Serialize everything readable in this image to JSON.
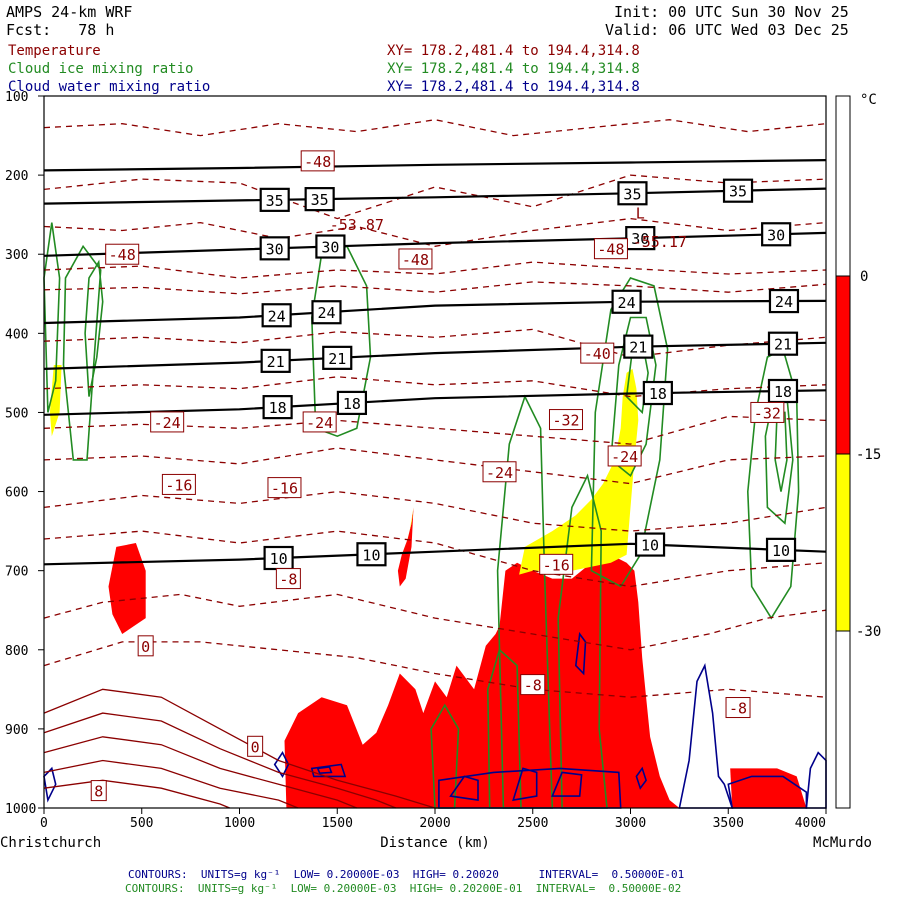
{
  "header": {
    "model": "AMPS 24-km WRF",
    "forecast": "Fcst:   78 h",
    "init": "Init: 00 UTC Sun 30 Nov 25",
    "valid": "Valid: 06 UTC Wed 03 Dec 25",
    "fields": [
      {
        "name": "Temperature",
        "xy": "XY= 178.2,481.4 to 194.4,314.8",
        "color": "#8b0000"
      },
      {
        "name": "Cloud ice mixing ratio",
        "xy": "XY= 178.2,481.4 to 194.4,314.8",
        "color": "#228b22"
      },
      {
        "name": "Cloud water mixing ratio",
        "xy": "XY= 178.2,481.4 to 194.4,314.8",
        "color": "#00008b"
      }
    ]
  },
  "footer": {
    "line1": "CONTOURS:  UNITS=g kg⁻¹  LOW= 0.20000E-03  HIGH= 0.20020      INTERVAL=  0.50000E-01",
    "line2": "CONTOURS:  UNITS=g kg⁻¹  LOW= 0.20000E-03  HIGH= 0.20200E-01  INTERVAL=  0.50000E-02",
    "line1_color": "#00008b",
    "line2_color": "#228b22"
  },
  "colorbar": {
    "unit": "°C",
    "labels": [
      "0",
      "-15",
      "-30"
    ],
    "colors": {
      "above": "#ffffff",
      "range_0_to_-15": "#ff0000",
      "range_-15_to_-30": "#ffff00",
      "below": "#ffffff"
    }
  },
  "chart_data": {
    "type": "contour cross-section",
    "xlabel": "Distance (km)",
    "x_start_label": "Christchurch",
    "x_end_label": "McMurdo",
    "xlim": [
      0,
      4000
    ],
    "x_ticks": [
      0,
      500,
      1000,
      1500,
      2000,
      2500,
      3000,
      3500,
      4000
    ],
    "ylim_hPa": [
      1000,
      100
    ],
    "y_ticks": [
      100,
      200,
      300,
      400,
      500,
      600,
      700,
      800,
      900,
      1000
    ],
    "black_isolines": [
      {
        "label": "10",
        "points": [
          [
            0,
            692
          ],
          [
            1000,
            686
          ],
          [
            2000,
            676
          ],
          [
            3000,
            666
          ],
          [
            4000,
            676
          ]
        ],
        "labels_at": [
          1200,
          1675,
          3100,
          3770
        ]
      },
      {
        "label": "18",
        "points": [
          [
            0,
            503
          ],
          [
            1000,
            496
          ],
          [
            2000,
            482
          ],
          [
            3000,
            476
          ],
          [
            4000,
            472
          ]
        ],
        "labels_at": [
          1195,
          1575,
          3140,
          3780
        ]
      },
      {
        "label": "21",
        "points": [
          [
            0,
            445
          ],
          [
            1000,
            437
          ],
          [
            2000,
            425
          ],
          [
            3000,
            417
          ],
          [
            4000,
            412
          ]
        ],
        "labels_at": [
          1185,
          1500,
          3040,
          3780
        ]
      },
      {
        "label": "24",
        "points": [
          [
            0,
            387
          ],
          [
            1000,
            380
          ],
          [
            2000,
            365
          ],
          [
            3000,
            360
          ],
          [
            4000,
            359
          ]
        ],
        "labels_at": [
          1190,
          1445,
          2980,
          3785
        ]
      },
      {
        "label": "30",
        "points": [
          [
            0,
            302
          ],
          [
            1000,
            294
          ],
          [
            2000,
            286
          ],
          [
            3000,
            280
          ],
          [
            4000,
            273
          ]
        ],
        "labels_at": [
          1180,
          1465,
          3050,
          3745
        ]
      },
      {
        "label": "35",
        "points": [
          [
            0,
            236
          ],
          [
            1000,
            232
          ],
          [
            2000,
            228
          ],
          [
            3000,
            223
          ],
          [
            4000,
            217
          ]
        ],
        "labels_at": [
          1180,
          1410,
          3010,
          3550
        ]
      },
      {
        "label": "",
        "points": [
          [
            0,
            194
          ],
          [
            1000,
            191
          ],
          [
            2000,
            187
          ],
          [
            3000,
            184
          ],
          [
            4000,
            181
          ]
        ],
        "labels_at": []
      }
    ],
    "temperature_labels": [
      {
        "text": "-48",
        "x": 1400,
        "p": 182
      },
      {
        "text": "-48",
        "x": 400,
        "p": 300
      },
      {
        "text": "-48",
        "x": 1900,
        "p": 306
      },
      {
        "text": "-48",
        "x": 2900,
        "p": 293
      },
      {
        "text": "-40",
        "x": 2830,
        "p": 425
      },
      {
        "text": "-32",
        "x": 2670,
        "p": 509
      },
      {
        "text": "-32",
        "x": 3700,
        "p": 500
      },
      {
        "text": "-24",
        "x": 630,
        "p": 512
      },
      {
        "text": "-24",
        "x": 1410,
        "p": 512
      },
      {
        "text": "-24",
        "x": 2330,
        "p": 575
      },
      {
        "text": "-24",
        "x": 2970,
        "p": 555
      },
      {
        "text": "-16",
        "x": 690,
        "p": 591
      },
      {
        "text": "-16",
        "x": 1230,
        "p": 595
      },
      {
        "text": "-16",
        "x": 2620,
        "p": 692
      },
      {
        "text": "-8",
        "x": 1250,
        "p": 710
      },
      {
        "text": "-8",
        "x": 2500,
        "p": 844
      },
      {
        "text": "-8",
        "x": 3550,
        "p": 873
      },
      {
        "text": "0",
        "x": 520,
        "p": 795
      },
      {
        "text": "0",
        "x": 1080,
        "p": 922
      },
      {
        "text": "8",
        "x": 280,
        "p": 978
      },
      {
        "text": "-53.87",
        "x": 1600,
        "p": 262
      },
      {
        "text": "-55.17",
        "x": 3150,
        "p": 283
      },
      {
        "text": "L",
        "x": 3050,
        "p": 247
      }
    ]
  }
}
